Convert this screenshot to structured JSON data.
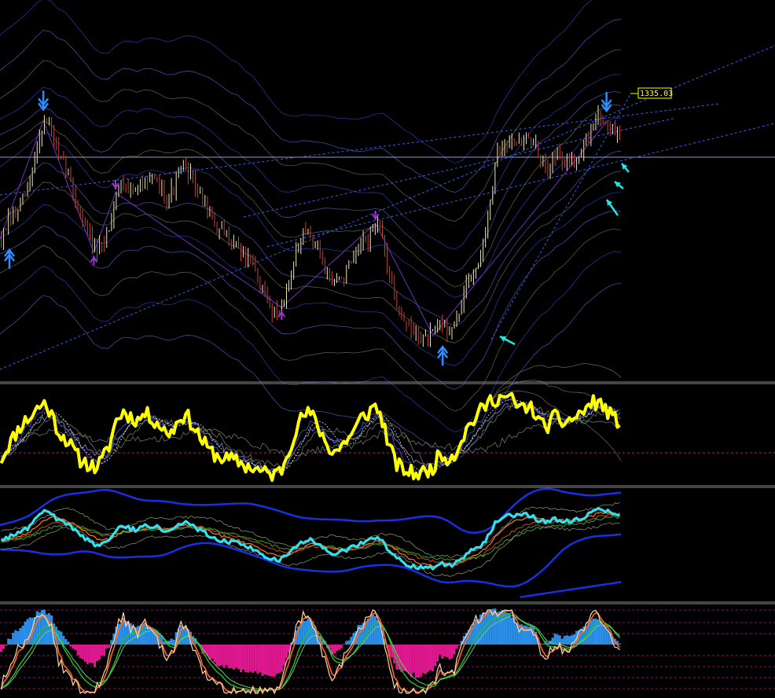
{
  "chart_data": {
    "type": "line",
    "title": "",
    "price_tag": {
      "value": 1335.03,
      "label": "1335.03"
    },
    "panes": [
      {
        "name": "price",
        "series": [
          {
            "name": "",
            "kind": "candles",
            "y": [
              1279.0,
              1285.3,
              1288.6,
              1294.0,
              1300.0,
              1315.8,
              1325.2,
              1321.9,
              1309.5,
              1307.8,
              1297.8,
              1288.9,
              1282.8,
              1273.7,
              1275.2,
              1283.9,
              1297.1,
              1301.9,
              1298.1,
              1296.8,
              1304.3,
              1301.2,
              1299.5,
              1295.2,
              1298.7,
              1306.0,
              1305.7,
              1299.8,
              1294.2,
              1288.2,
              1282.7,
              1280.4,
              1278.6,
              1276.0,
              1272.1,
              1268.0,
              1261.1,
              1254.0,
              1251.0,
              1252.3,
              1262.8,
              1272.5,
              1279.9,
              1280.7,
              1275.7,
              1268.4,
              1262.1,
              1262.6,
              1266.8,
              1270.1,
              1276.6,
              1278.9,
              1285.1,
              1279.5,
              1264.9,
              1254.0,
              1247.3,
              1243.2,
              1240.8,
              1240.1,
              1241.2,
              1246.1,
              1244.1,
              1244.4,
              1253.6,
              1262.8,
              1268.4,
              1275.1,
              1292.6,
              1311.2,
              1316.0,
              1319.7,
              1316.7,
              1318.6,
              1316.9,
              1308.3,
              1308.1,
              1312.3,
              1308.6,
              1309.7,
              1311.3,
              1315.5,
              1321.8,
              1327.6,
              1324.7,
              1320.1,
              1318.5
            ]
          },
          {
            "name": "",
            "kind": "envelope",
            "y": [
              1299.8,
              1301.7,
              1303.4,
              1305.5,
              1307.9,
              1310.8,
              1313.0,
              1312.2,
              1309.4,
              1308.4,
              1305.5,
              1302.4,
              1299.4,
              1295.9,
              1294.6,
              1294.9,
              1297.8,
              1299.9,
              1300.2,
              1299.6,
              1301.0,
              1301.2,
              1300.4,
              1299.2,
              1299.1,
              1299.9,
              1300.1,
              1299.3,
              1297.8,
              1296.3,
              1293.9,
              1291.4,
              1289.0,
              1287.7,
              1284.7,
              1282.9,
              1279.7,
              1276.0,
              1272.8,
              1270.2,
              1269.6,
              1269.7,
              1270.8,
              1270.9,
              1271.0,
              1271.1,
              1270.6,
              1270.0,
              1269.8,
              1269.2,
              1269.2,
              1269.5,
              1270.1,
              1270.0,
              1267.6,
              1264.9,
              1262.2,
              1260.4,
              1257.8,
              1255.9,
              1254.1,
              1252.4,
              1250.2,
              1249.2,
              1250.5,
              1254.1,
              1257.1,
              1260.4,
              1265.9,
              1272.5,
              1277.5,
              1282.2,
              1286.5,
              1290.2,
              1293.7,
              1296.5,
              1298.0,
              1301.0,
              1302.8,
              1305.5,
              1308.7,
              1311.7,
              1313.6,
              1315.5,
              1317.0,
              1318.1,
              1318.1
            ]
          }
        ]
      },
      {
        "name": "oscillator-1",
        "series": [
          {
            "name": "",
            "y": [
              22,
              38,
              52,
              65,
              71,
              82,
              88,
              75,
              54,
              46,
              33,
              21,
              17,
              12,
              20,
              38,
              68,
              78,
              72,
              68,
              76,
              70,
              63,
              52,
              58,
              74,
              71,
              57,
              43,
              32,
              26,
              23,
              21,
              19,
              14,
              12,
              8,
              5,
              4,
              10,
              34,
              58,
              74,
              76,
              62,
              44,
              31,
              34,
              45,
              54,
              70,
              76,
              86,
              68,
              35,
              16,
              9,
              6,
              5,
              7,
              12,
              28,
              24,
              27,
              46,
              61,
              72,
              82,
              91,
              94,
              95,
              92,
              82,
              84,
              80,
              63,
              62,
              72,
              65,
              68,
              72,
              79,
              87,
              90,
              81,
              71,
              66
            ]
          }
        ]
      },
      {
        "name": "oscillator-2",
        "series": [
          {
            "name": "",
            "y": [
              1278.0,
              1284.0,
              1287.0,
              1293.0,
              1300.0,
              1314.0,
              1323.0,
              1320.0,
              1308.0,
              1306.0,
              1296.0,
              1287.0,
              1281.0,
              1272.0,
              1274.0,
              1282.0,
              1296.0,
              1300.0,
              1297.0,
              1295.0,
              1303.0,
              1300.0,
              1298.0,
              1294.0,
              1297.0,
              1305.0,
              1304.0,
              1298.0,
              1293.0,
              1287.0,
              1281.0,
              1279.0,
              1277.0,
              1275.0,
              1271.0,
              1267.0,
              1260.0,
              1253.0,
              1250.0,
              1251.0,
              1261.0,
              1271.0,
              1278.0,
              1279.0,
              1274.0,
              1267.0,
              1261.0,
              1261.0,
              1265.0,
              1269.0,
              1275.0,
              1277.0,
              1284.0,
              1278.0,
              1263.0,
              1253.0,
              1246.0,
              1242.0,
              1239.0,
              1239.0,
              1240.0,
              1245.0,
              1243.0,
              1243.0,
              1252.0,
              1261.0,
              1267.0,
              1274.0,
              1291.0,
              1310.0,
              1315.0,
              1318.0,
              1315.0,
              1317.0,
              1315.0,
              1307.0,
              1307.0,
              1311.0,
              1307.0,
              1308.0,
              1310.0,
              1314.0,
              1320.0,
              1326.0,
              1323.0,
              1319.0,
              1317.0
            ]
          }
        ]
      },
      {
        "name": "oscillator-3",
        "series": [
          {
            "name": "",
            "y": [
              10,
              30,
              48,
              60,
              74,
              88,
              95,
              78,
              40,
              25,
              12,
              5,
              3,
              2,
              15,
              42,
              80,
              92,
              78,
              70,
              85,
              72,
              58,
              40,
              52,
              80,
              74,
              50,
              28,
              15,
              8,
              6,
              5,
              4,
              3,
              2,
              2,
              2,
              2,
              10,
              45,
              78,
              92,
              90,
              68,
              40,
              22,
              28,
              48,
              62,
              82,
              90,
              97,
              70,
              25,
              6,
              3,
              2,
              2,
              3,
              8,
              30,
              22,
              28,
              58,
              78,
              88,
              95,
              98,
              99,
              99,
              95,
              78,
              82,
              74,
              45,
              42,
              62,
              50,
              56,
              64,
              78,
              92,
              96,
              80,
              58,
              46
            ]
          },
          {
            "name": "",
            "kind": "histogram",
            "y": [
              -8,
              6,
              18,
              26,
              34,
              42,
              46,
              36,
              18,
              8,
              -6,
              -16,
              -24,
              -28,
              -18,
              -2,
              24,
              34,
              28,
              22,
              30,
              24,
              14,
              2,
              8,
              26,
              22,
              6,
              -10,
              -20,
              -26,
              -30,
              -32,
              -34,
              -36,
              -38,
              -40,
              -42,
              -42,
              -34,
              -8,
              18,
              34,
              34,
              20,
              2,
              -12,
              -8,
              4,
              14,
              28,
              34,
              40,
              22,
              -14,
              -32,
              -38,
              -40,
              -42,
              -40,
              -34,
              -16,
              -20,
              -16,
              6,
              22,
              32,
              40,
              46,
              46,
              44,
              38,
              26,
              28,
              22,
              4,
              2,
              16,
              8,
              12,
              16,
              24,
              32,
              36,
              24,
              10,
              4
            ]
          }
        ]
      }
    ],
    "annotations": [
      {
        "type": "arrow-down",
        "index": 6
      },
      {
        "type": "arrow-down",
        "index": 84
      },
      {
        "type": "arrow-up",
        "index": 0
      },
      {
        "type": "arrow-up",
        "index": 60
      },
      {
        "type": "marker-up",
        "index": 13
      },
      {
        "type": "marker-up",
        "index": 39
      },
      {
        "type": "marker-down",
        "index": 16
      },
      {
        "type": "marker-down",
        "index": 52
      }
    ],
    "colors": {
      "background": "#000000",
      "candle_up": "#f0e6b0",
      "candle_down": "#c0443a",
      "price_tag_border": "#ffff00",
      "osc1_line": "#ffff00",
      "osc2_line": "#33e0ee",
      "band_thick": "#1a2fe0",
      "hist_positive": "#2a8fe8",
      "hist_negative": "#e0188f",
      "osc3_fast": "#ffd8b0",
      "osc3_slow": "#ff6a1a",
      "osc3_signal": "#24c02a",
      "arrow_primary": "#2f8cff",
      "arrow_cyan": "#22e5e5",
      "marker": "#a030d8",
      "trendline": "#3a5fe8"
    }
  }
}
